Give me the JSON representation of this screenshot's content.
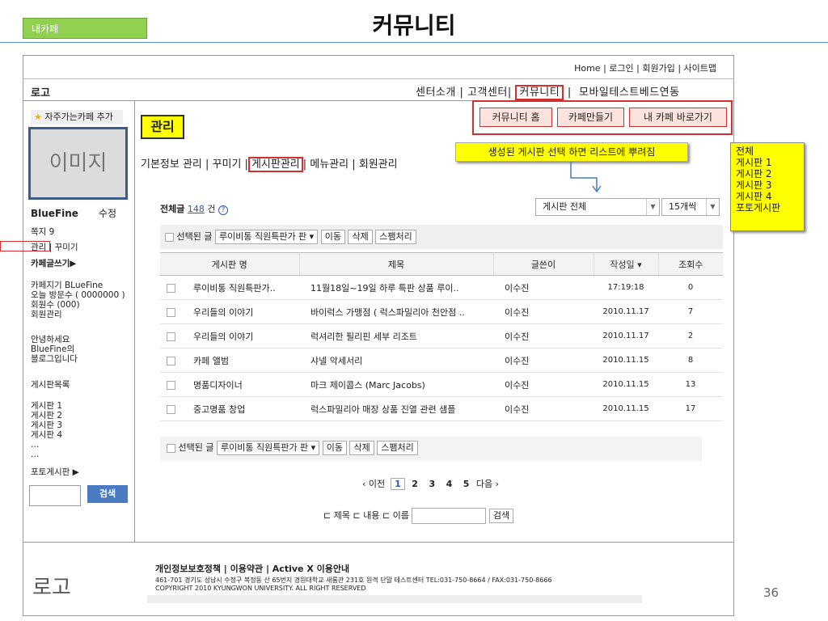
{
  "slide": {
    "tag": "내카페",
    "title": "커뮤니티",
    "page_number": "36"
  },
  "header": {
    "top_links": "Home | 로그인 | 회원가입 | 사이트맵",
    "logo": "로고",
    "nav": [
      "센터소개",
      "고객센터",
      "커뮤니티",
      "모바일테스트베드연동"
    ]
  },
  "community_buttons": [
    "커뮤니티 홈",
    "카페만들기",
    "내 카페 바로가기"
  ],
  "sidebar": {
    "favorite": "자주가는카페 추가",
    "image_label": "이미지",
    "cafe_name": "BlueFine",
    "edit": "수정",
    "messages": "쪽지 9",
    "manage_links": "관리 | 꾸미기",
    "write": "카페글쓰기▶",
    "info": [
      "카페지기 BLueFine",
      "오늘 방문수 ( 0000000 )",
      "회원수 (000)",
      "회원관리"
    ],
    "greeting": [
      "안녕하세요",
      "BlueFine의",
      "블로그입니다"
    ],
    "board_list_title": "게시판목록",
    "boards": [
      "게시판 1",
      "게시판 2",
      "게시판 3",
      "게시판 4",
      "…",
      "…"
    ],
    "photo_board": "포토게시판 ▶",
    "search_button": "검색"
  },
  "main": {
    "section_title": "관리",
    "tabs_before": "기본정보 관리 | 꾸미기 |",
    "tab_active": "게시판관리",
    "tabs_after": "| 메뉴관리 | 회원관리",
    "note": "생성된 게시판 선택 하면 리스트에 뿌려짐",
    "dropdown_list": [
      "전체",
      "게시판 1",
      "게시판 2",
      "게시판 3",
      "게시판 4",
      "포토게시판"
    ],
    "total_prefix": "전체글",
    "total_count": "148",
    "total_suffix": "건",
    "board_filter": "게시판 전체",
    "per_page": "15개씩",
    "action_bar": {
      "selected": "선택된 글",
      "board_select": "루이비통 직원특판가 판",
      "move": "이동",
      "delete": "삭제",
      "spam": "스팸처리"
    },
    "table": {
      "headers": [
        "게시판 명",
        "제목",
        "글쓴이",
        "작성일 ▾",
        "조회수"
      ],
      "rows": [
        [
          "루이비통 직원특판가..",
          "11월18일~19일 하루 특판 상품 루이..",
          "이수진",
          "17:19:18",
          "0"
        ],
        [
          "우리들의 이야기",
          "바이럭스 가맹점 ( 럭스파밀리아 천안점 ..",
          "이수진",
          "2010.11.17",
          "7"
        ],
        [
          "우리들의 이야기",
          "럭셔리한 필리핀 세부 리조트",
          "이수진",
          "2010.11.17",
          "2"
        ],
        [
          "카페 앨범",
          "샤넬 악세서리",
          "이수진",
          "2010.11.15",
          "8"
        ],
        [
          "명품디자이너",
          "마크 제이콥스 (Marc Jacobs)",
          "이수진",
          "2010.11.15",
          "13"
        ],
        [
          "중고명품 창업",
          "럭스파밀리아 매장 상품 진열 관련 샘플",
          "이수진",
          "2010.11.15",
          "17"
        ]
      ]
    },
    "pager": {
      "prev": "‹ 이전",
      "pages": [
        "1",
        "2",
        "3",
        "4",
        "5"
      ],
      "next": "다음 ›"
    },
    "bottom_search": {
      "options": [
        "제목",
        "내용",
        "이름"
      ],
      "button": "검색"
    }
  },
  "footer": {
    "logo": "로고",
    "links": "개인정보보호정책 | 이용약관 | Active X 이용안내",
    "address": "461-701 경기도 성남시 수정구 복정동 산 65번지 경원대학교 새롬관 231호 원격 단말 테스트센터 TEL:031-750-8664 / FAX:031-750-8666",
    "copyright": "COPYRIGHT 2010 KYUNGWON UNIVERSITY. ALL RIGHT RESERVED"
  }
}
